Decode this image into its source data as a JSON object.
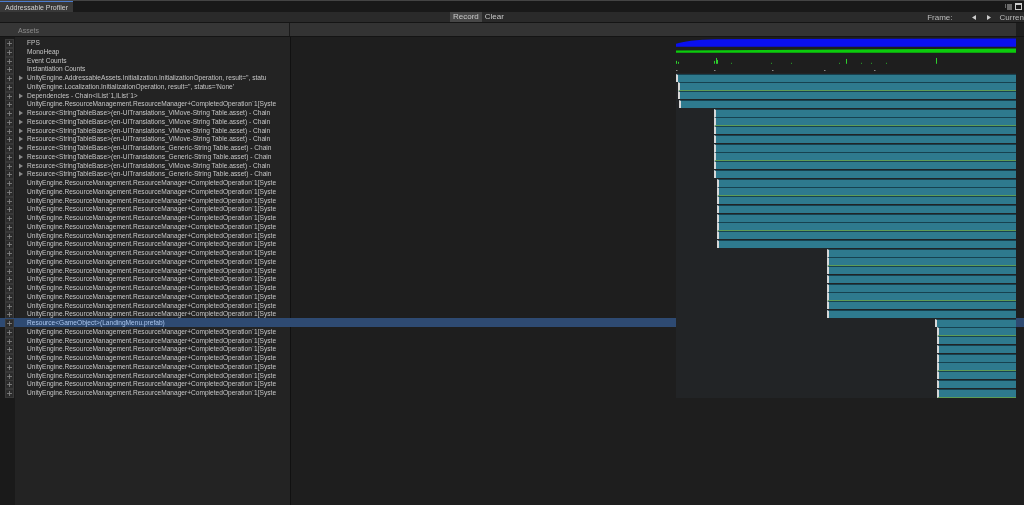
{
  "tab": {
    "title": "Addressable Profiler",
    "selected": true
  },
  "toolbar": {
    "buttons": [
      {
        "label": "Record",
        "selected": true
      },
      {
        "label": "Clear",
        "selected": false
      }
    ],
    "frame_label": "Frame:",
    "current": "Curren"
  },
  "header": {
    "column_1": "Assets"
  },
  "rows": [
    {
      "kind": "fps",
      "name": "FPS",
      "expandable": false,
      "selected": false
    },
    {
      "kind": "memory",
      "name": "MonoHeap",
      "expandable": false,
      "selected": false
    },
    {
      "kind": "events",
      "name": "Event Counts",
      "expandable": false,
      "selected": false
    },
    {
      "kind": "instantiations",
      "name": "Instantiation Counts",
      "expandable": false,
      "selected": false
    },
    {
      "kind": "operation",
      "name": "UnityEngine.AddressableAssets.Initialization.InitializationOperation, result='', statu",
      "expandable": true,
      "selected": false,
      "level": 1
    },
    {
      "kind": "operation",
      "name": "UnityEngine.Localization.InitializationOperation, result='', status='None'",
      "expandable": false,
      "selected": false,
      "level": 0.994
    },
    {
      "kind": "operation",
      "name": "Dependencies - Chain<IList`1,IList`1>",
      "expandable": true,
      "selected": false,
      "level": 0.994
    },
    {
      "kind": "operation",
      "name": "UnityEngine.ResourceManagement.ResourceManager+CompletedOperation`1[Syste",
      "expandable": false,
      "selected": false,
      "level": 0.99
    },
    {
      "kind": "operation",
      "name": "Resource<StringTableBase>(en-UITranslations_ViMove-String Table.asset) - Chain",
      "expandable": true,
      "selected": false,
      "level": 0.888
    },
    {
      "kind": "operation",
      "name": "Resource<StringTableBase>(en-UITranslations_ViMove-String Table.asset) - Chain",
      "expandable": true,
      "selected": false,
      "level": 0.888
    },
    {
      "kind": "operation",
      "name": "Resource<StringTableBase>(en-UITranslations_ViMove-String Table.asset) - Chain",
      "expandable": true,
      "selected": false,
      "level": 0.888
    },
    {
      "kind": "operation",
      "name": "Resource<StringTableBase>(en-UITranslations_ViMove-String Table.asset) - Chain",
      "expandable": true,
      "selected": false,
      "level": 0.888
    },
    {
      "kind": "operation",
      "name": "Resource<StringTableBase>(en-UITranslations_Generic-String Table.asset) - Chain",
      "expandable": true,
      "selected": false,
      "level": 0.888
    },
    {
      "kind": "operation",
      "name": "Resource<StringTableBase>(en-UITranslations_Generic-String Table.asset) - Chain",
      "expandable": true,
      "selected": false,
      "level": 0.888
    },
    {
      "kind": "operation",
      "name": "Resource<StringTableBase>(en-UITranslations_ViMove-String Table.asset) - Chain",
      "expandable": true,
      "selected": false,
      "level": 0.888
    },
    {
      "kind": "operation",
      "name": "Resource<StringTableBase>(en-UITranslations_Generic-String Table.asset) - Chain",
      "expandable": true,
      "selected": false,
      "level": 0.888
    },
    {
      "kind": "operation",
      "name": "UnityEngine.ResourceManagement.ResourceManager+CompletedOperation`1[Syste",
      "expandable": false,
      "selected": false,
      "level": 0.88
    },
    {
      "kind": "operation",
      "name": "UnityEngine.ResourceManagement.ResourceManager+CompletedOperation`1[Syste",
      "expandable": false,
      "selected": false,
      "level": 0.88
    },
    {
      "kind": "operation",
      "name": "UnityEngine.ResourceManagement.ResourceManager+CompletedOperation`1[Syste",
      "expandable": false,
      "selected": false,
      "level": 0.88
    },
    {
      "kind": "operation",
      "name": "UnityEngine.ResourceManagement.ResourceManager+CompletedOperation`1[Syste",
      "expandable": false,
      "selected": false,
      "level": 0.88
    },
    {
      "kind": "operation",
      "name": "UnityEngine.ResourceManagement.ResourceManager+CompletedOperation`1[Syste",
      "expandable": false,
      "selected": false,
      "level": 0.88
    },
    {
      "kind": "operation",
      "name": "UnityEngine.ResourceManagement.ResourceManager+CompletedOperation`1[Syste",
      "expandable": false,
      "selected": false,
      "level": 0.88
    },
    {
      "kind": "operation",
      "name": "UnityEngine.ResourceManagement.ResourceManager+CompletedOperation`1[Syste",
      "expandable": false,
      "selected": false,
      "level": 0.88
    },
    {
      "kind": "operation",
      "name": "UnityEngine.ResourceManagement.ResourceManager+CompletedOperation`1[Syste",
      "expandable": false,
      "selected": false,
      "level": 0.88
    },
    {
      "kind": "operation",
      "name": "UnityEngine.ResourceManagement.ResourceManager+CompletedOperation`1[Syste",
      "expandable": false,
      "selected": false,
      "level": 0.556
    },
    {
      "kind": "operation",
      "name": "UnityEngine.ResourceManagement.ResourceManager+CompletedOperation`1[Syste",
      "expandable": false,
      "selected": false,
      "level": 0.556
    },
    {
      "kind": "operation",
      "name": "UnityEngine.ResourceManagement.ResourceManager+CompletedOperation`1[Syste",
      "expandable": false,
      "selected": false,
      "level": 0.556
    },
    {
      "kind": "operation",
      "name": "UnityEngine.ResourceManagement.ResourceManager+CompletedOperation`1[Syste",
      "expandable": false,
      "selected": false,
      "level": 0.556
    },
    {
      "kind": "operation",
      "name": "UnityEngine.ResourceManagement.ResourceManager+CompletedOperation`1[Syste",
      "expandable": false,
      "selected": false,
      "level": 0.556
    },
    {
      "kind": "operation",
      "name": "UnityEngine.ResourceManagement.ResourceManager+CompletedOperation`1[Syste",
      "expandable": false,
      "selected": false,
      "level": 0.556
    },
    {
      "kind": "operation",
      "name": "UnityEngine.ResourceManagement.ResourceManager+CompletedOperation`1[Syste",
      "expandable": false,
      "selected": false,
      "level": 0.556
    },
    {
      "kind": "operation",
      "name": "UnityEngine.ResourceManagement.ResourceManager+CompletedOperation`1[Syste",
      "expandable": false,
      "selected": false,
      "level": 0.556
    },
    {
      "kind": "operation",
      "name": "Resource<GameObject>(LandingMenu.prefab)",
      "expandable": false,
      "selected": true,
      "level": 0.238
    },
    {
      "kind": "operation",
      "name": "UnityEngine.ResourceManagement.ResourceManager+CompletedOperation`1[Syste",
      "expandable": false,
      "selected": false,
      "level": 0.232
    },
    {
      "kind": "operation",
      "name": "UnityEngine.ResourceManagement.ResourceManager+CompletedOperation`1[Syste",
      "expandable": false,
      "selected": false,
      "level": 0.232
    },
    {
      "kind": "operation",
      "name": "UnityEngine.ResourceManagement.ResourceManager+CompletedOperation`1[Syste",
      "expandable": false,
      "selected": false,
      "level": 0.232
    },
    {
      "kind": "operation",
      "name": "UnityEngine.ResourceManagement.ResourceManager+CompletedOperation`1[Syste",
      "expandable": false,
      "selected": false,
      "level": 0.232
    },
    {
      "kind": "operation",
      "name": "UnityEngine.ResourceManagement.ResourceManager+CompletedOperation`1[Syste",
      "expandable": false,
      "selected": false,
      "level": 0.232
    },
    {
      "kind": "operation",
      "name": "UnityEngine.ResourceManagement.ResourceManager+CompletedOperation`1[Syste",
      "expandable": false,
      "selected": false,
      "level": 0.232
    },
    {
      "kind": "operation",
      "name": "UnityEngine.ResourceManagement.ResourceManager+CompletedOperation`1[Syste",
      "expandable": false,
      "selected": false,
      "level": 0.232
    },
    {
      "kind": "operation",
      "name": "UnityEngine.ResourceManagement.ResourceManager+CompletedOperation`1[Syste",
      "expandable": false,
      "selected": false,
      "level": 0.232
    }
  ]
}
